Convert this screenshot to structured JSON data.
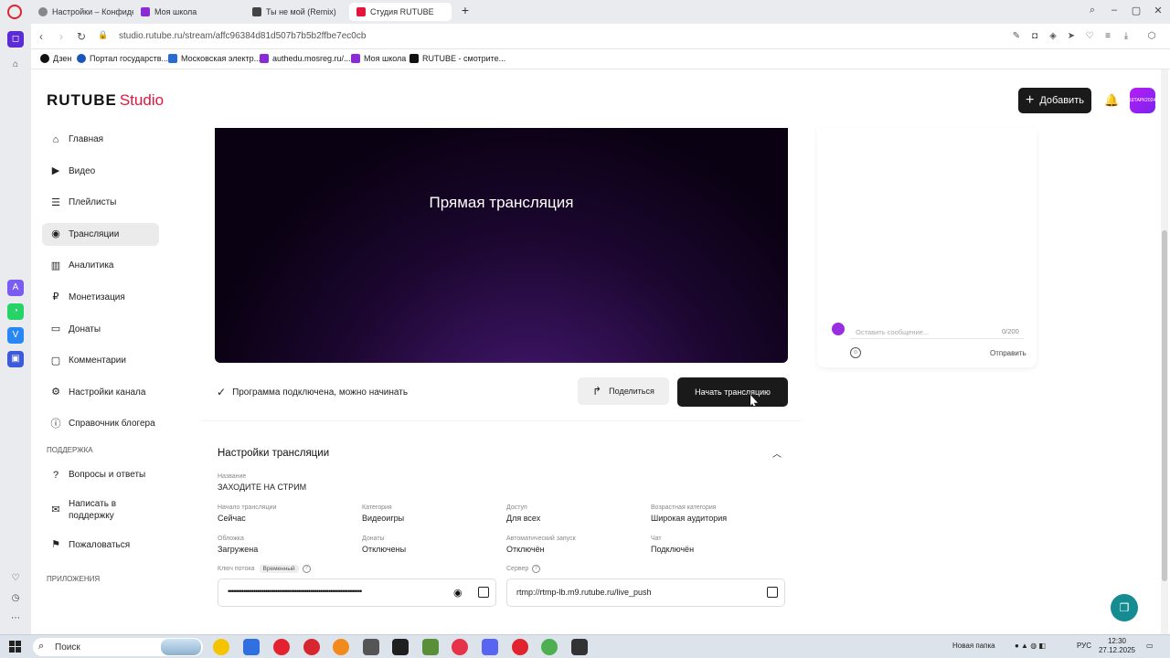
{
  "browser": {
    "tabs": [
      {
        "label": "Настройки – Конфиденц",
        "icon": "gear-icon",
        "color": "#666666"
      },
      {
        "label": "Моя школа",
        "icon": "school-icon",
        "color": "#8b2bd6"
      },
      {
        "label": "Ты не мой (Remix)",
        "icon": "music-icon",
        "color": "#444444"
      },
      {
        "label": "Студия RUTUBE",
        "icon": "rutube-icon",
        "color": "#e4153b"
      }
    ],
    "url": "studio.rutube.ru/stream/affc96384d81d507b7b5b2ffbe7ec0cb",
    "bookmarks": [
      {
        "label": "Дзен",
        "color": "#111111"
      },
      {
        "label": "Портал государств...",
        "color": "#1a55b8"
      },
      {
        "label": "Московская электр...",
        "color": "#2a6bd1"
      },
      {
        "label": "authedu.mosreg.ru/...",
        "color": "#8b2bd6"
      },
      {
        "label": "Моя школа",
        "color": "#8b2bd6"
      },
      {
        "label": "RUTUBE - смотрите...",
        "color": "#111111"
      }
    ]
  },
  "header": {
    "logo_main": "RUTUBE",
    "logo_studio": "Studio",
    "add_label": "Добавить",
    "avatar_text": "ШТАРК2024"
  },
  "sidebar": {
    "items": [
      {
        "label": "Главная",
        "icon": "home-icon",
        "glyph": "⌂"
      },
      {
        "label": "Видео",
        "icon": "video-icon",
        "glyph": "▶"
      },
      {
        "label": "Плейлисты",
        "icon": "playlist-icon",
        "glyph": "☰"
      },
      {
        "label": "Трансляции",
        "icon": "broadcast-icon",
        "glyph": "◉"
      },
      {
        "label": "Аналитика",
        "icon": "analytics-icon",
        "glyph": "▥"
      },
      {
        "label": "Монетизация",
        "icon": "ruble-icon",
        "glyph": "₽"
      },
      {
        "label": "Донаты",
        "icon": "donate-icon",
        "glyph": "▭"
      },
      {
        "label": "Комментарии",
        "icon": "comments-icon",
        "glyph": "▢"
      },
      {
        "label": "Настройки канала",
        "icon": "gear-icon",
        "glyph": "⚙"
      },
      {
        "label": "Справочник блогера",
        "icon": "info-icon",
        "glyph": "ⓘ"
      }
    ],
    "support_title": "ПОДДЕРЖКА",
    "support_items": [
      {
        "label": "Вопросы и ответы",
        "icon": "question-icon",
        "glyph": "?"
      },
      {
        "label": "Написать в поддержку",
        "icon": "mail-icon",
        "glyph": "✉"
      },
      {
        "label": "Пожаловаться",
        "icon": "flag-icon",
        "glyph": "⚑"
      }
    ],
    "apps_title": "ПРИЛОЖЕНИЯ"
  },
  "player": {
    "title": "Прямая трансляция"
  },
  "status": {
    "text": "Программа подключена, можно начинать",
    "share_label": "Поделиться",
    "start_label": "Начать трансляцию"
  },
  "settings": {
    "title": "Настройки трансляции",
    "name_label": "Название",
    "name_value": "ЗАХОДИТЕ НА СТРИМ",
    "fields": [
      {
        "label": "Начало трансляции",
        "value": "Сейчас"
      },
      {
        "label": "Категория",
        "value": "Видеоигры"
      },
      {
        "label": "Доступ",
        "value": "Для всех"
      },
      {
        "label": "Возрастная категория",
        "value": "Широкая аудитория"
      },
      {
        "label": "Обложка",
        "value": "Загружена"
      },
      {
        "label": "Донаты",
        "value": "Отключены"
      },
      {
        "label": "Автоматический запуск",
        "value": "Отключён"
      },
      {
        "label": "Чат",
        "value": "Подключён"
      }
    ],
    "key_label": "Ключ потока",
    "key_badge": "Временный",
    "key_value": "••••••••••••••••••••••••••••••••••••••••••••••••••••••••••••••••••••",
    "server_label": "Сервер",
    "server_value": "rtmp://rtmp-lb.m9.rutube.ru/live_push"
  },
  "chat": {
    "placeholder": "Оставить сообщение...",
    "counter": "0/200",
    "send_label": "Отправить"
  },
  "taskbar": {
    "search_label": "Поиск",
    "folder_label": "Новая папка",
    "lang": "РУС",
    "time": "12:30",
    "date": "27.12.2025"
  }
}
